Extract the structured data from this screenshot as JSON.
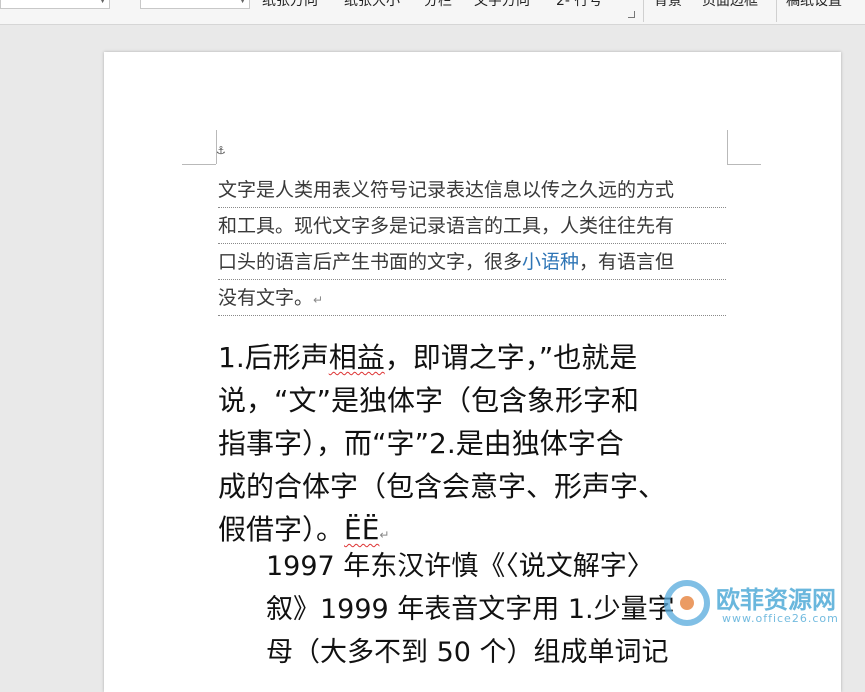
{
  "ribbon": {
    "items": [
      {
        "label": "纸张方向"
      },
      {
        "label": "纸张大小"
      },
      {
        "label": "分栏"
      },
      {
        "label": "文字方向"
      },
      {
        "label": "行号"
      },
      {
        "label": "背景"
      },
      {
        "label": "页面边框"
      },
      {
        "label": "稿纸设置"
      }
    ]
  },
  "document": {
    "paragraph1": {
      "lines": [
        "文字是人类用表义符号记录表达信息以传之久远的方式",
        "和工具。现代文字多是记录语言的工具，人类往往先有",
        "口头的语言后产生书面的文字，很多",
        "没有文字。"
      ],
      "link_text": "小语种",
      "line3_tail": "，有语言但"
    },
    "paragraph2": {
      "line1_pre": "1.后形声",
      "line1_squiggle": "相益",
      "line1_post": "，即谓之字，”也就是",
      "line2": "说，“文”是独体字（包含象形字和",
      "line3": "指事字），而“字”2.是由独体字合",
      "line4": "成的合体字（包含会意字、形声字、",
      "line5_pre": "假借字）。",
      "line5_squiggle": "ËË"
    },
    "paragraph3": {
      "lines": [
        "1997 年东汉许慎《〈说文解字〉",
        "叙》1999 年表音文字用 1.少量字",
        "母（大多不到 50 个）组成单词记"
      ]
    }
  },
  "watermark": {
    "text": "欧菲资源网",
    "url": "www.office26.com"
  }
}
